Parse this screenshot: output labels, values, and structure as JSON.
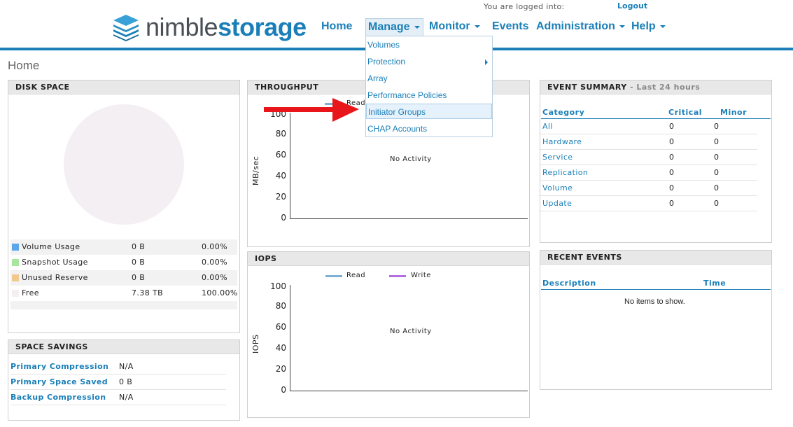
{
  "header": {
    "logged_in_text": "You are logged into:",
    "logout_label": "Logout",
    "logo_part1": "nimble",
    "logo_part2": "storage",
    "logo_icon": "stacked-layers-icon"
  },
  "nav": {
    "home": "Home",
    "manage": "Manage",
    "monitor": "Monitor",
    "events": "Events",
    "administration": "Administration",
    "help": "Help"
  },
  "manage_menu": {
    "items": [
      "Volumes",
      "Protection",
      "Array",
      "Performance Policies",
      "Initiator Groups",
      "CHAP Accounts"
    ],
    "highlighted": "Initiator Groups"
  },
  "page_title": "Home",
  "disk_space": {
    "title": "DISK SPACE",
    "rows": [
      {
        "name": "Volume Usage",
        "size": "0 B",
        "pct": "0.00%",
        "color": "#5aa6e8"
      },
      {
        "name": "Snapshot Usage",
        "size": "0 B",
        "pct": "0.00%",
        "color": "#a8e6a0"
      },
      {
        "name": "Unused Reserve",
        "size": "0 B",
        "pct": "0.00%",
        "color": "#f0c890"
      },
      {
        "name": "Free",
        "size": "7.38 TB",
        "pct": "100.00%",
        "color": "#f4eff2"
      }
    ]
  },
  "space_savings": {
    "title": "SPACE SAVINGS",
    "rows": [
      {
        "name": "Primary Compression",
        "value": "N/A"
      },
      {
        "name": "Primary Space Saved",
        "value": "0 B"
      },
      {
        "name": "Backup Compression",
        "value": "N/A"
      }
    ]
  },
  "throughput": {
    "title": "THROUGHPUT",
    "legend_read": "Read",
    "ylabel": "MB/sec",
    "ticks": [
      "100",
      "80",
      "60",
      "40",
      "20",
      "0"
    ],
    "no_activity": "No Activity"
  },
  "iops": {
    "title": "IOPS",
    "legend_read": "Read",
    "legend_write": "Write",
    "ylabel": "IOPS",
    "ticks": [
      "100",
      "80",
      "60",
      "40",
      "20",
      "0"
    ],
    "no_activity": "No Activity"
  },
  "event_summary": {
    "title": "EVENT SUMMARY",
    "subtitle": "- Last 24 hours",
    "columns": [
      "Category",
      "Critical",
      "Minor"
    ],
    "rows": [
      {
        "category": "All",
        "critical": "0",
        "minor": "0"
      },
      {
        "category": "Hardware",
        "critical": "0",
        "minor": "0"
      },
      {
        "category": "Service",
        "critical": "0",
        "minor": "0"
      },
      {
        "category": "Replication",
        "critical": "0",
        "minor": "0"
      },
      {
        "category": "Volume",
        "critical": "0",
        "minor": "0"
      },
      {
        "category": "Update",
        "critical": "0",
        "minor": "0"
      }
    ]
  },
  "recent_events": {
    "title": "RECENT EVENTS",
    "columns": [
      "Description",
      "Time"
    ],
    "empty_text": "No items to show."
  },
  "colors": {
    "brand": "#1a7fb8",
    "read_line": "#7fb0d4",
    "write_line": "#b36fe0",
    "annotation_arrow": "#e8151b"
  }
}
